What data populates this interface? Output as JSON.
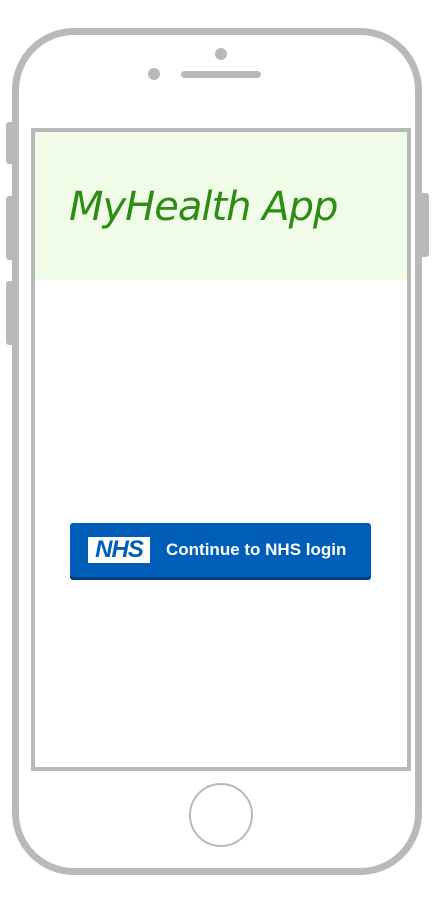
{
  "app": {
    "title": "MyHealth App"
  },
  "login": {
    "logo_text": "NHS",
    "button_label": "Continue to NHS login"
  },
  "colors": {
    "header_background": "#f0fbe8",
    "title_green": "#2e8b14",
    "nhs_blue": "#005eb8",
    "device_frame": "#b9b9b9"
  },
  "icons": {
    "logo": "nhs-logo-icon"
  }
}
